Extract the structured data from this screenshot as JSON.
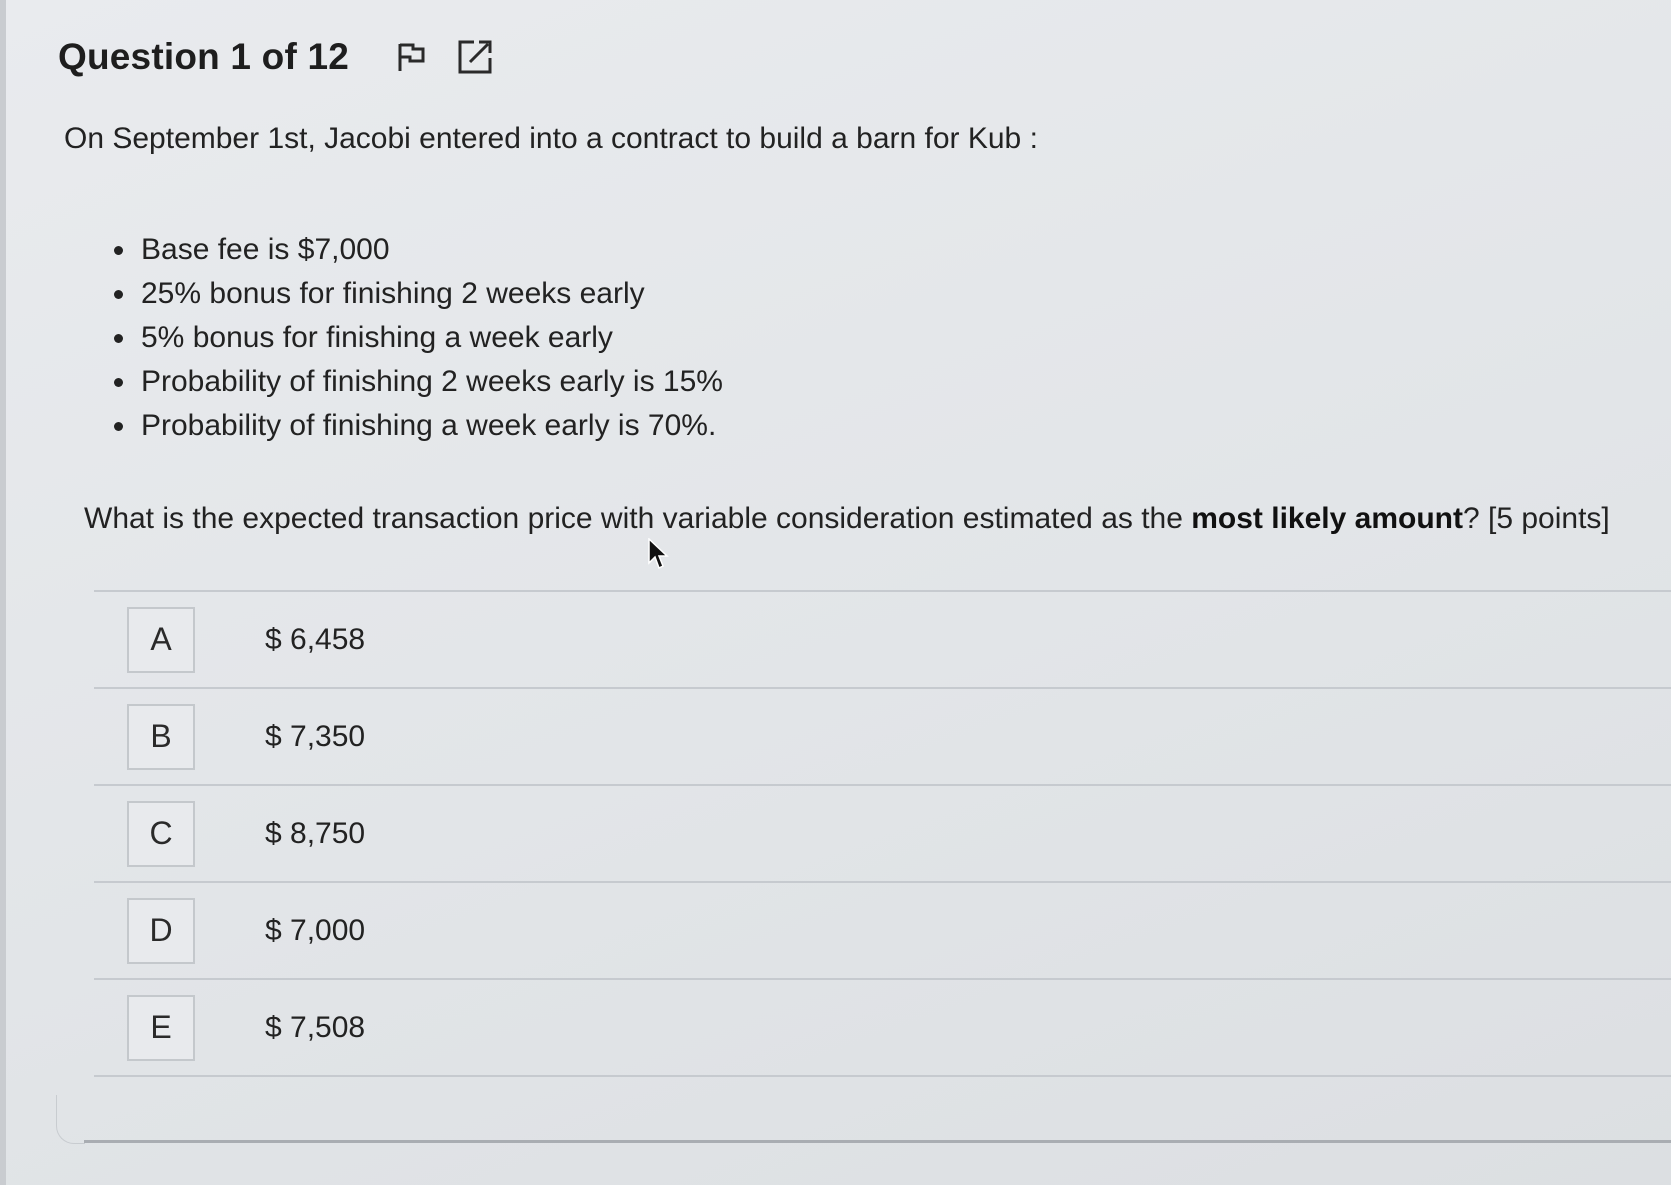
{
  "header": {
    "title": "Question 1 of 12",
    "flag_icon": "flag-icon",
    "popout_icon": "external-link-icon"
  },
  "intro": "On September 1st, Jacobi entered into a contract to build a barn for Kub :",
  "facts": [
    "Base fee is $7,000",
    "25% bonus for finishing 2 weeks early",
    "5% bonus for finishing a week early",
    "Probability of finishing 2 weeks early is 15%",
    "Probability of finishing a week early is 70%."
  ],
  "question": {
    "before": "What is the expected transaction price with variable consideration estimated as the ",
    "bold": "most likely amount",
    "after": "? [5 points]"
  },
  "options": [
    {
      "letter": "A",
      "value": "$ 6,458"
    },
    {
      "letter": "B",
      "value": "$ 7,350"
    },
    {
      "letter": "C",
      "value": "$ 8,750"
    },
    {
      "letter": "D",
      "value": "$ 7,000"
    },
    {
      "letter": "E",
      "value": "$ 7,508"
    }
  ]
}
